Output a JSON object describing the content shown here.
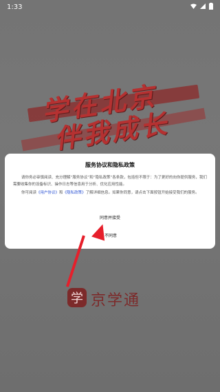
{
  "status_bar": {
    "time": "1:33",
    "wifi_icon": "wifi-icon",
    "signal_icon": "signal-icon",
    "battery_icon": "battery-icon"
  },
  "splash": {
    "slogan_line1": "学在北京",
    "slogan_line2": "伴我成长",
    "logo_text": "京学通",
    "logo_icon": "app-logo-icon"
  },
  "dialog": {
    "title": "服务协议和隐私政策",
    "paragraph1": "请你务必审慎阅读、充分理解“服务协议”和“隐私政策”各条款，包括但不限于：为了更好的向你提供服务，我们需要收集你的设备标识、操作日志等信息用于分析、优化应用性能。",
    "paragraph2_prefix": "你可阅读",
    "user_agreement_link": "《用户协议》",
    "and_text": "和",
    "privacy_policy_link": "《隐私政策》",
    "paragraph2_suffix": "了解详细信息。如果你同意，请点击下面按钮开始接受我们的服务。",
    "agree_button": "同意并接受",
    "disagree_button": "不同意"
  },
  "annotation": {
    "arrow_color": "#e61f2b"
  }
}
